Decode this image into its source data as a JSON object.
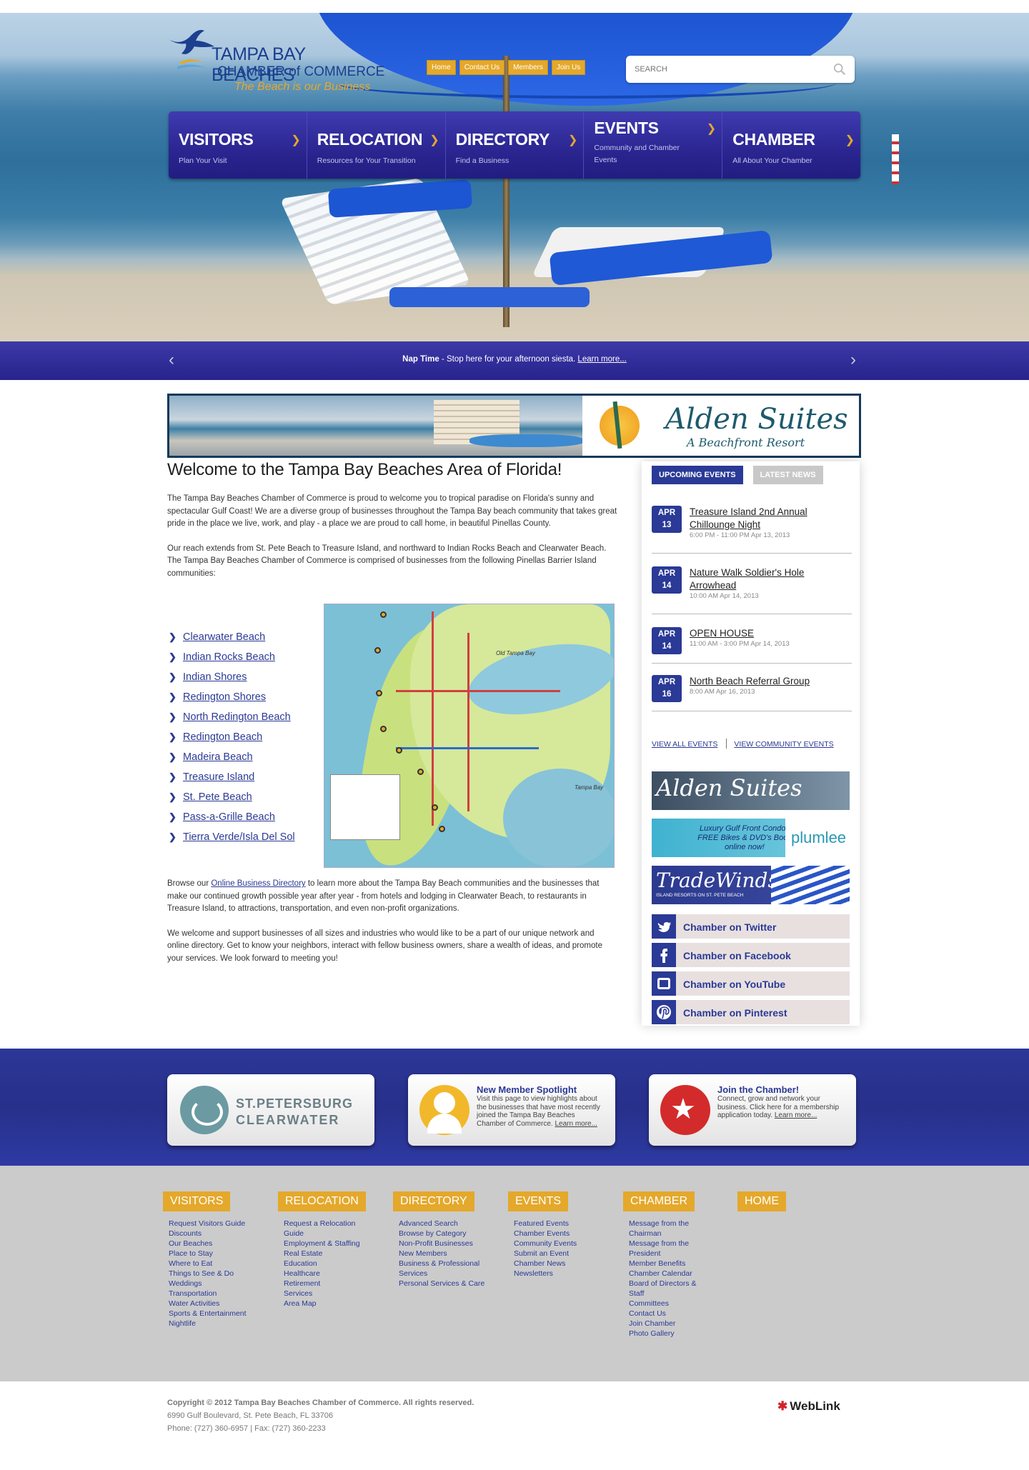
{
  "header": {
    "logo_line1": "TAMPA BAY BEACHES",
    "logo_line2": "CHAMBER of COMMERCE",
    "logo_tagline": "The Beach is our Business",
    "top_links": [
      "Home",
      "Contact Us",
      "Members",
      "Join Us"
    ],
    "search_placeholder": "SEARCH"
  },
  "main_nav": [
    {
      "title": "VISITORS",
      "sub": "Plan Your Visit"
    },
    {
      "title": "RELOCATION",
      "sub": "Resources for Your Transition"
    },
    {
      "title": "DIRECTORY",
      "sub": "Find a Business"
    },
    {
      "title": "EVENTS",
      "sub": "Community and Chamber Events"
    },
    {
      "title": "CHAMBER",
      "sub": "All About Your Chamber"
    }
  ],
  "slider": {
    "caption_bold": "Nap Time",
    "caption_text": " - Stop here for your afternoon siesta. ",
    "caption_link": "Learn more..."
  },
  "ad_banner": {
    "name": "Alden Suites",
    "tagline": "A Beachfront Resort"
  },
  "welcome": {
    "heading": "Welcome to the Tampa Bay Beaches Area of Florida!",
    "p1": "The Tampa Bay Beaches Chamber of Commerce is proud to welcome you to tropical paradise on Florida's sunny and spectacular Gulf Coast! We are a diverse group of businesses throughout the Tampa Bay beach community that takes great pride in the place we live, work, and play - a place we are proud to call home, in beautiful Pinellas County.",
    "p2": "Our reach extends from St. Pete Beach to Treasure Island, and northward to Indian Rocks Beach and Clearwater Beach. The Tampa Bay Beaches Chamber of Commerce is comprised of businesses from the following Pinellas Barrier Island communities:",
    "communities": [
      "Clearwater Beach",
      "Indian Rocks Beach",
      "Indian Shores",
      "Redington Shores",
      "North Redington Beach",
      "Redington Beach",
      "Madeira Beach",
      "Treasure Island",
      "St. Pete Beach",
      "Pass-a-Grille Beach",
      "Tierra Verde/Isla Del Sol"
    ],
    "p3_before": "Browse our ",
    "p3_link": "Online Business Directory",
    "p3_after": " to learn more about the Tampa Bay Beach communities and the businesses that make our continued growth possible year after year - from hotels and lodging in Clearwater Beach, to restaurants in Treasure Island, to attractions, transportation, and even non-profit organizations.",
    "p4": "We welcome and support businesses of all sizes and industries who would like to be a part of our unique network and online directory. Get to know your neighbors, interact with fellow business owners, share a wealth of ideas, and promote your services. We look forward to meeting you!"
  },
  "map": {
    "labels": [
      "Old Tampa Bay",
      "Tampa Bay"
    ]
  },
  "sidebar": {
    "tab_events": "UPCOMING EVENTS",
    "tab_news": "LATEST NEWS",
    "events": [
      {
        "month": "APR",
        "day": "13",
        "title": "Treasure Island 2nd Annual Chillounge Night",
        "time": "6:00 PM - 11:00 PM Apr 13, 2013"
      },
      {
        "month": "APR",
        "day": "14",
        "title": "Nature Walk Soldier's Hole Arrowhead",
        "time": "10:00 AM Apr 14, 2013"
      },
      {
        "month": "APR",
        "day": "14",
        "title": "OPEN HOUSE",
        "time": "11:00 AM - 3:00 PM Apr 14, 2013"
      },
      {
        "month": "APR",
        "day": "16",
        "title": "North Beach Referral Group",
        "time": "8:00 AM Apr 16, 2013"
      }
    ],
    "view_all": "VIEW ALL EVENTS",
    "view_community": "VIEW COMMUNITY EVENTS",
    "ads": {
      "alden": "Alden Suites",
      "plumlee_text": "Luxury Gulf Front Condos FREE Bikes & DVD's Book online now!",
      "plumlee_brand": "plumlee",
      "tradewinds": "TradeWinds",
      "tradewinds_sub": "ISLAND RESORTS ON ST. PETE BEACH"
    },
    "social": [
      {
        "icon": "twitter-icon",
        "label": "Chamber on Twitter"
      },
      {
        "icon": "facebook-icon",
        "label": "Chamber on Facebook"
      },
      {
        "icon": "youtube-icon",
        "label": "Chamber on YouTube"
      },
      {
        "icon": "pinterest-icon",
        "label": "Chamber on Pinterest"
      }
    ]
  },
  "promo": {
    "card1_line1": "ST.PETERSBURG",
    "card1_line2": "CLEARWATER",
    "card2_title": "New Member Spotlight",
    "card2_text": "Visit this page to view highlights about the businesses that have most recently joined the Tampa Bay Beaches Chamber of Commerce.",
    "card2_link": "Learn more...",
    "card3_title": "Join the Chamber!",
    "card3_text": "Connect, grow and network your business. Click here for a membership application today.",
    "card3_link": "Learn more..."
  },
  "footer_nav": [
    {
      "heading": "VISITORS",
      "items": [
        "Request Visitors Guide",
        "Discounts",
        "Our Beaches",
        "Place to Stay",
        "Where to Eat",
        "Things to See & Do",
        "Weddings",
        "Transportation",
        "Water Activities",
        "Sports & Entertainment",
        "Nightlife"
      ]
    },
    {
      "heading": "RELOCATION",
      "items": [
        "Request a Relocation Guide",
        "Employment & Staffing",
        "Real Estate",
        "Education",
        "Healthcare",
        "Retirement",
        "Services",
        "Area Map"
      ]
    },
    {
      "heading": "DIRECTORY",
      "items": [
        "Advanced Search",
        "Browse by Category",
        "Non-Profit Businesses",
        "New Members",
        "Business & Professional Services",
        "Personal Services & Care"
      ]
    },
    {
      "heading": "EVENTS",
      "items": [
        "Featured Events",
        "Chamber Events",
        "Community Events",
        "Submit an Event",
        "Chamber News",
        "Newsletters"
      ]
    },
    {
      "heading": "CHAMBER",
      "items": [
        "Message from the Chairman",
        "Message from the President",
        "Member Benefits",
        "Chamber Calendar",
        "Board of Directors & Staff",
        "Committees",
        "Contact Us",
        "Join Chamber",
        "Photo Gallery"
      ]
    },
    {
      "heading": "HOME",
      "items": []
    }
  ],
  "copyright": {
    "line1": "Copyright © 2012 Tampa Bay Beaches Chamber of Commerce.  All rights reserved.",
    "line2": "6990 Gulf Boulevard, St. Pete Beach, FL 33706",
    "line3": "Phone: (727) 360-6957 | Fax: (727) 360-2233",
    "brand": "WebLink"
  },
  "colors": {
    "primary_blue": "#2a3a96",
    "accent_gold": "#e4a82b",
    "footer_gray": "#cbcbcb"
  }
}
